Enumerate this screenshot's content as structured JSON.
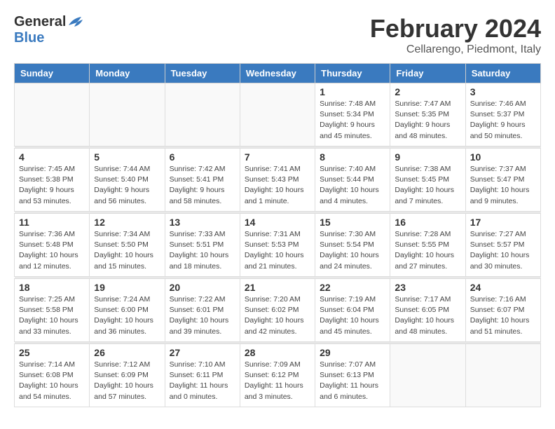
{
  "header": {
    "logo_general": "General",
    "logo_blue": "Blue",
    "month_title": "February 2024",
    "location": "Cellarengo, Piedmont, Italy"
  },
  "days_of_week": [
    "Sunday",
    "Monday",
    "Tuesday",
    "Wednesday",
    "Thursday",
    "Friday",
    "Saturday"
  ],
  "weeks": [
    {
      "days": [
        {
          "number": "",
          "info": "",
          "empty": true
        },
        {
          "number": "",
          "info": "",
          "empty": true
        },
        {
          "number": "",
          "info": "",
          "empty": true
        },
        {
          "number": "",
          "info": "",
          "empty": true
        },
        {
          "number": "1",
          "info": "Sunrise: 7:48 AM\nSunset: 5:34 PM\nDaylight: 9 hours\nand 45 minutes.",
          "empty": false
        },
        {
          "number": "2",
          "info": "Sunrise: 7:47 AM\nSunset: 5:35 PM\nDaylight: 9 hours\nand 48 minutes.",
          "empty": false
        },
        {
          "number": "3",
          "info": "Sunrise: 7:46 AM\nSunset: 5:37 PM\nDaylight: 9 hours\nand 50 minutes.",
          "empty": false
        }
      ]
    },
    {
      "days": [
        {
          "number": "4",
          "info": "Sunrise: 7:45 AM\nSunset: 5:38 PM\nDaylight: 9 hours\nand 53 minutes.",
          "empty": false
        },
        {
          "number": "5",
          "info": "Sunrise: 7:44 AM\nSunset: 5:40 PM\nDaylight: 9 hours\nand 56 minutes.",
          "empty": false
        },
        {
          "number": "6",
          "info": "Sunrise: 7:42 AM\nSunset: 5:41 PM\nDaylight: 9 hours\nand 58 minutes.",
          "empty": false
        },
        {
          "number": "7",
          "info": "Sunrise: 7:41 AM\nSunset: 5:43 PM\nDaylight: 10 hours\nand 1 minute.",
          "empty": false
        },
        {
          "number": "8",
          "info": "Sunrise: 7:40 AM\nSunset: 5:44 PM\nDaylight: 10 hours\nand 4 minutes.",
          "empty": false
        },
        {
          "number": "9",
          "info": "Sunrise: 7:38 AM\nSunset: 5:45 PM\nDaylight: 10 hours\nand 7 minutes.",
          "empty": false
        },
        {
          "number": "10",
          "info": "Sunrise: 7:37 AM\nSunset: 5:47 PM\nDaylight: 10 hours\nand 9 minutes.",
          "empty": false
        }
      ]
    },
    {
      "days": [
        {
          "number": "11",
          "info": "Sunrise: 7:36 AM\nSunset: 5:48 PM\nDaylight: 10 hours\nand 12 minutes.",
          "empty": false
        },
        {
          "number": "12",
          "info": "Sunrise: 7:34 AM\nSunset: 5:50 PM\nDaylight: 10 hours\nand 15 minutes.",
          "empty": false
        },
        {
          "number": "13",
          "info": "Sunrise: 7:33 AM\nSunset: 5:51 PM\nDaylight: 10 hours\nand 18 minutes.",
          "empty": false
        },
        {
          "number": "14",
          "info": "Sunrise: 7:31 AM\nSunset: 5:53 PM\nDaylight: 10 hours\nand 21 minutes.",
          "empty": false
        },
        {
          "number": "15",
          "info": "Sunrise: 7:30 AM\nSunset: 5:54 PM\nDaylight: 10 hours\nand 24 minutes.",
          "empty": false
        },
        {
          "number": "16",
          "info": "Sunrise: 7:28 AM\nSunset: 5:55 PM\nDaylight: 10 hours\nand 27 minutes.",
          "empty": false
        },
        {
          "number": "17",
          "info": "Sunrise: 7:27 AM\nSunset: 5:57 PM\nDaylight: 10 hours\nand 30 minutes.",
          "empty": false
        }
      ]
    },
    {
      "days": [
        {
          "number": "18",
          "info": "Sunrise: 7:25 AM\nSunset: 5:58 PM\nDaylight: 10 hours\nand 33 minutes.",
          "empty": false
        },
        {
          "number": "19",
          "info": "Sunrise: 7:24 AM\nSunset: 6:00 PM\nDaylight: 10 hours\nand 36 minutes.",
          "empty": false
        },
        {
          "number": "20",
          "info": "Sunrise: 7:22 AM\nSunset: 6:01 PM\nDaylight: 10 hours\nand 39 minutes.",
          "empty": false
        },
        {
          "number": "21",
          "info": "Sunrise: 7:20 AM\nSunset: 6:02 PM\nDaylight: 10 hours\nand 42 minutes.",
          "empty": false
        },
        {
          "number": "22",
          "info": "Sunrise: 7:19 AM\nSunset: 6:04 PM\nDaylight: 10 hours\nand 45 minutes.",
          "empty": false
        },
        {
          "number": "23",
          "info": "Sunrise: 7:17 AM\nSunset: 6:05 PM\nDaylight: 10 hours\nand 48 minutes.",
          "empty": false
        },
        {
          "number": "24",
          "info": "Sunrise: 7:16 AM\nSunset: 6:07 PM\nDaylight: 10 hours\nand 51 minutes.",
          "empty": false
        }
      ]
    },
    {
      "days": [
        {
          "number": "25",
          "info": "Sunrise: 7:14 AM\nSunset: 6:08 PM\nDaylight: 10 hours\nand 54 minutes.",
          "empty": false
        },
        {
          "number": "26",
          "info": "Sunrise: 7:12 AM\nSunset: 6:09 PM\nDaylight: 10 hours\nand 57 minutes.",
          "empty": false
        },
        {
          "number": "27",
          "info": "Sunrise: 7:10 AM\nSunset: 6:11 PM\nDaylight: 11 hours\nand 0 minutes.",
          "empty": false
        },
        {
          "number": "28",
          "info": "Sunrise: 7:09 AM\nSunset: 6:12 PM\nDaylight: 11 hours\nand 3 minutes.",
          "empty": false
        },
        {
          "number": "29",
          "info": "Sunrise: 7:07 AM\nSunset: 6:13 PM\nDaylight: 11 hours\nand 6 minutes.",
          "empty": false
        },
        {
          "number": "",
          "info": "",
          "empty": true
        },
        {
          "number": "",
          "info": "",
          "empty": true
        }
      ]
    }
  ]
}
